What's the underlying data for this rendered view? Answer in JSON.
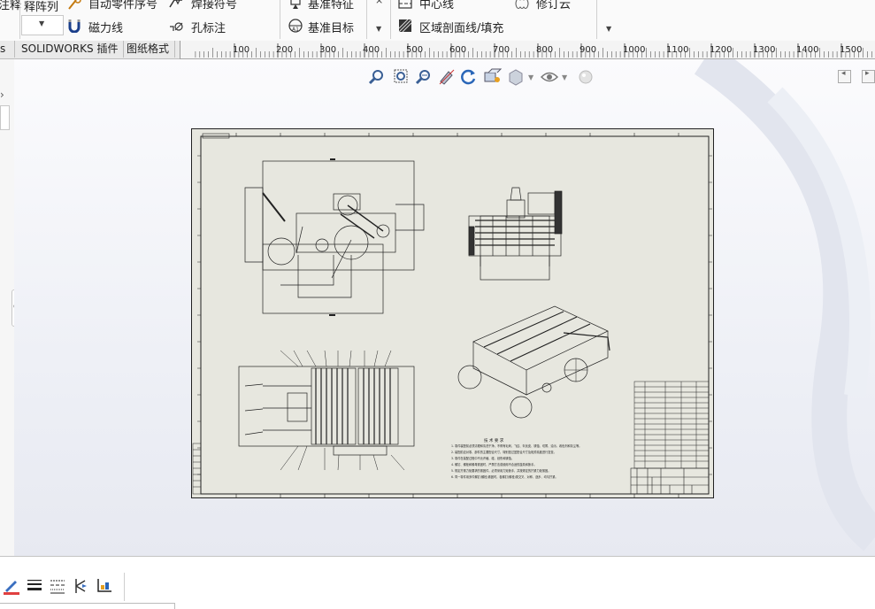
{
  "ribbon": {
    "left_partial_label": "注释",
    "pattern_label": "释阵列",
    "auto_balloon_label": "自动零件序号",
    "magnet_line_label": "磁力线",
    "weld_symbol_label": "焊接符号",
    "hole_callout_label": "孔标注",
    "datum_feature_label": "基准特征",
    "datum_target_label": "基准目标",
    "centerline_label": "中心线",
    "area_hatch_label": "区域剖面线/填充",
    "revision_cloud_label": "修订云"
  },
  "tabs": [
    {
      "label": "SOLIDWORKS 插件"
    },
    {
      "label": "图纸格式"
    }
  ],
  "ruler": {
    "ticks": [
      "100",
      "200",
      "300",
      "400",
      "500",
      "600",
      "700",
      "800",
      "900",
      "1000",
      "1100",
      "1200",
      "1300",
      "1400",
      "1500"
    ]
  },
  "heads_up_toolbar": {
    "icons": [
      "zoom-to-fit-icon",
      "zoom-to-area-icon",
      "previous-view-icon",
      "section-view-icon",
      "rotate-view-icon",
      "view-orientation-icon",
      "display-style-icon",
      "hide-show-items-icon",
      "edit-appearance-icon"
    ]
  },
  "drawing": {
    "tech_req_title": "技 术 要 求",
    "tech_req_lines": [
      "1. 零件装配前必须清理和清洗干净，不得有毛刺、飞边、氧化皮、锈蚀、切屑、油污、着色剂和灰尘等。",
      "2. 装配前应对零、部件的主要配合尺寸，特别是过盈配合尺寸及相关精度进行复查。",
      "3. 零件在装配过程中不允许磕、碰、划伤和锈蚀。",
      "4. 螺钉、螺栓和螺母紧固时，严禁打击或使用不合适的旋具和扳手。",
      "5. 规定拧紧力矩要求的紧固件，必须采用力矩扳手，并按规定的拧紧力矩紧固。",
      "6. 同一零件用多件螺钉(螺栓)紧固时，各螺钉(螺栓)需交叉、对称、逐步、均匀拧紧。"
    ]
  },
  "bottom_toolbar": {
    "icons": [
      "line-color-icon",
      "line-thickness-icon",
      "line-style-icon",
      "hide-show-edges-icon",
      "color-display-mode-icon"
    ]
  },
  "colors": {
    "sheet": "#e7e7df",
    "ribbon_bg": "#fafafa",
    "canvas_top": "#fbfbfd",
    "canvas_bottom": "#e7e9f1"
  }
}
